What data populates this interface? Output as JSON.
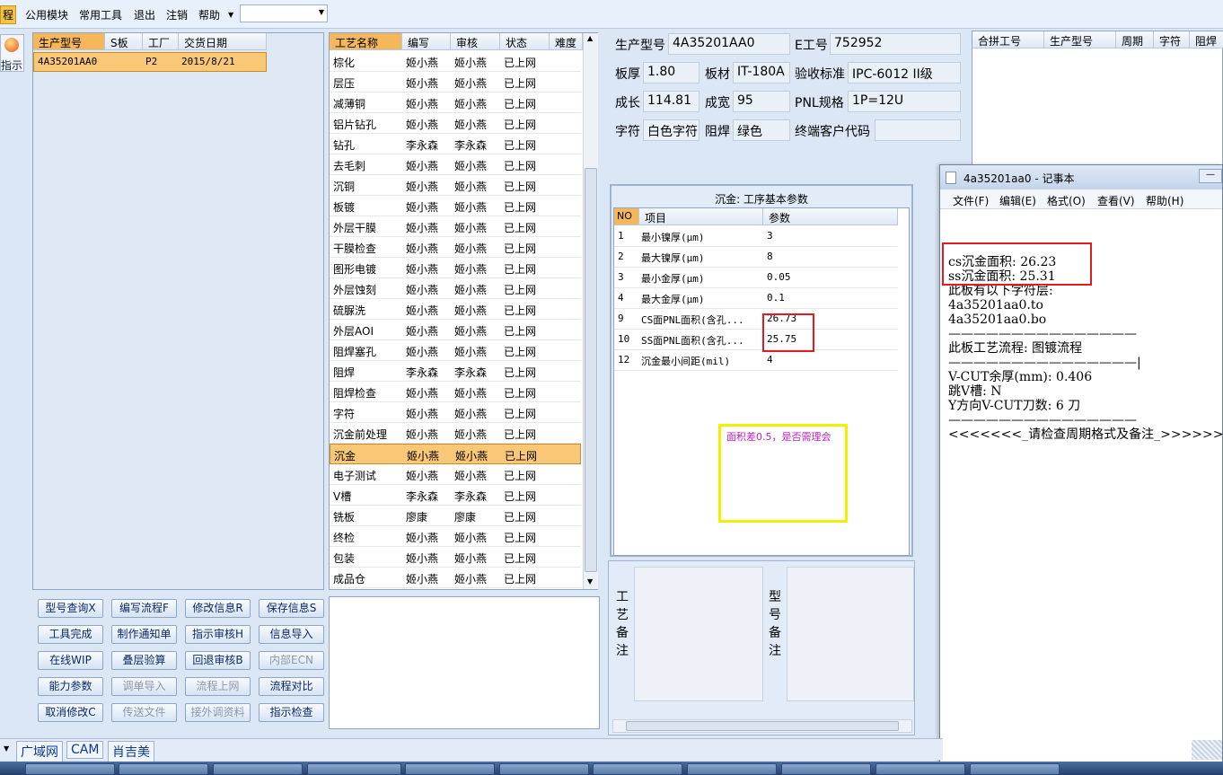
{
  "menu": {
    "flow": "程",
    "items": [
      "公用模块",
      "常用工具",
      "退出",
      "注销",
      "帮助"
    ]
  },
  "side": {
    "label": "指示"
  },
  "model_table": {
    "headers": [
      "生产型号",
      "S板",
      "工厂",
      "交货日期"
    ],
    "row": {
      "model": "4A35201AA0",
      "factory": "P2",
      "date": "2015/8/21"
    }
  },
  "process_table": {
    "headers": [
      "工艺名称",
      "编写",
      "审核",
      "状态",
      "难度"
    ],
    "rows": [
      [
        "棕化",
        "姬小燕",
        "姬小燕",
        "已上网"
      ],
      [
        "层压",
        "姬小燕",
        "姬小燕",
        "已上网"
      ],
      [
        "减薄铜",
        "姬小燕",
        "姬小燕",
        "已上网"
      ],
      [
        "铝片钻孔",
        "姬小燕",
        "姬小燕",
        "已上网"
      ],
      [
        "钻孔",
        "李永森",
        "李永森",
        "已上网"
      ],
      [
        "去毛刺",
        "姬小燕",
        "姬小燕",
        "已上网"
      ],
      [
        "沉铜",
        "姬小燕",
        "姬小燕",
        "已上网"
      ],
      [
        "板镀",
        "姬小燕",
        "姬小燕",
        "已上网"
      ],
      [
        "外层干膜",
        "姬小燕",
        "姬小燕",
        "已上网"
      ],
      [
        "干膜检查",
        "姬小燕",
        "姬小燕",
        "已上网"
      ],
      [
        "图形电镀",
        "姬小燕",
        "姬小燕",
        "已上网"
      ],
      [
        "外层蚀刻",
        "姬小燕",
        "姬小燕",
        "已上网"
      ],
      [
        "硫脲洗",
        "姬小燕",
        "姬小燕",
        "已上网"
      ],
      [
        "外层AOI",
        "姬小燕",
        "姬小燕",
        "已上网"
      ],
      [
        "阻焊塞孔",
        "姬小燕",
        "姬小燕",
        "已上网"
      ],
      [
        "阻焊",
        "李永森",
        "李永森",
        "已上网"
      ],
      [
        "阻焊检查",
        "姬小燕",
        "姬小燕",
        "已上网"
      ],
      [
        "字符",
        "姬小燕",
        "姬小燕",
        "已上网"
      ],
      [
        "沉金前处理",
        "姬小燕",
        "姬小燕",
        "已上网"
      ],
      [
        "沉金",
        "姬小燕",
        "姬小燕",
        "已上网"
      ],
      [
        "电子测试",
        "姬小燕",
        "姬小燕",
        "已上网"
      ],
      [
        "V槽",
        "李永森",
        "李永森",
        "已上网"
      ],
      [
        "铣板",
        "廖康",
        "廖康",
        "已上网"
      ],
      [
        "终检",
        "姬小燕",
        "姬小燕",
        "已上网"
      ],
      [
        "包装",
        "姬小燕",
        "姬小燕",
        "已上网"
      ],
      [
        "成品仓",
        "姬小燕",
        "姬小燕",
        "已上网"
      ]
    ],
    "selected_index": 19
  },
  "buttons": [
    [
      "型号查询X",
      "编写流程F",
      "修改信息R",
      "保存信息S"
    ],
    [
      "工具完成",
      "制作通知单",
      "指示审核H",
      "信息导入"
    ],
    [
      "在线WIP",
      "叠层验算",
      "回退审核B",
      "内部ECN"
    ],
    [
      "能力参数",
      "调单导入",
      "流程上网",
      "流程对比"
    ],
    [
      "取消修改C",
      "传送文件",
      "接外调资料",
      "指示检查"
    ]
  ],
  "disabled_buttons": [
    "内部ECN",
    "调单导入",
    "流程上网",
    "传送文件",
    "接外调资料"
  ],
  "info": {
    "model_label": "生产型号",
    "model": "4A35201AA0",
    "eno_label": "E工号",
    "eno": "752952",
    "thick_label": "板厚",
    "thick": "1.80",
    "mat_label": "板材",
    "mat": "IT-180A",
    "std_label": "验收标准",
    "std": "IPC-6012 II级",
    "len_label": "成长",
    "len": "114.81",
    "wid_label": "成宽",
    "wid": "95",
    "pnl_label": "PNL规格",
    "pnl": "1P=12U",
    "char_label": "字符",
    "char": "白色字符",
    "mask_label": "阻焊",
    "mask": "绿色",
    "cust_label": "终端客户代码",
    "cust": ""
  },
  "merge_table": {
    "headers": [
      "合拼工号",
      "生产型号",
      "周期",
      "字符",
      "阻焊"
    ]
  },
  "params": {
    "title": "沉金: 工序基本参数",
    "headers": [
      "NO",
      "项目",
      "参数"
    ],
    "rows": [
      [
        "1",
        "最小镍厚(μm)",
        "3"
      ],
      [
        "2",
        "最大镍厚(μm)",
        "8"
      ],
      [
        "3",
        "最小金厚(μm)",
        "0.05"
      ],
      [
        "4",
        "最大金厚(μm)",
        "0.1"
      ],
      [
        "9",
        "CS面PNL面积(含孔...",
        "26.73"
      ],
      [
        "10",
        "SS面PNL面积(含孔...",
        "25.75"
      ],
      [
        "12",
        "沉金最小间距(mil)",
        "4"
      ]
    ]
  },
  "annotation": "面积差0.5，是否需理会",
  "remarks": {
    "process": "工艺备注",
    "model": "型号备注"
  },
  "notepad": {
    "title": "4a35201aa0 - 记事本",
    "menu": [
      "文件(F)",
      "编辑(E)",
      "格式(O)",
      "查看(V)",
      "帮助(H)"
    ],
    "text": "cs沉金面积: 26.23\nss沉金面积: 25.31\n此板有以下字符层:\n4a35201aa0.to\n4a35201aa0.bo\n———————————————\n此板工艺流程: 图镀流程\n———————————————|\nV-CUT余厚(mm): 0.406\n跳V槽: N\nY方向V-CUT刀数: 6 刀\n———————————————\n<<<<<<<_请检查周期格式及备注_>>>>>>>"
  },
  "status": {
    "items": [
      "广域网",
      "CAM",
      "肖吉美"
    ]
  }
}
